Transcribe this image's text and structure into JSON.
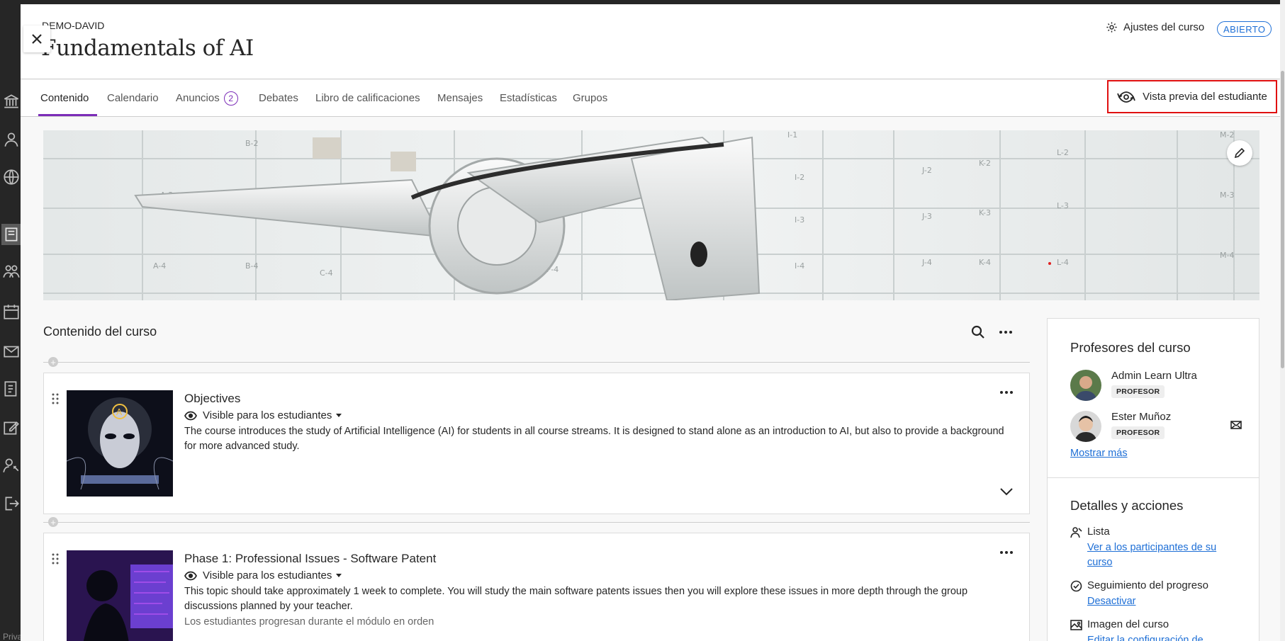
{
  "window": {
    "close_label": "Close"
  },
  "rail": {
    "items": [
      "institution-icon",
      "profile-icon",
      "globe-icon",
      "courses-icon",
      "organizations-icon",
      "calendar-icon",
      "messages-icon",
      "grades-icon",
      "edit-icon",
      "tools-icon",
      "signout-icon"
    ],
    "footer_text": "Priva"
  },
  "header": {
    "org": "DEMO-DAVID",
    "title": "Fundamentals of AI",
    "settings_label": "Ajustes del curso",
    "status_badge": "ABIERTO"
  },
  "nav": {
    "tabs": [
      {
        "label": "Contenido",
        "active": true
      },
      {
        "label": "Calendario"
      },
      {
        "label": "Anuncios",
        "count": "2"
      },
      {
        "label": "Debates"
      },
      {
        "label": "Libro de calificaciones"
      },
      {
        "label": "Mensajes"
      },
      {
        "label": "Estadísticas"
      },
      {
        "label": "Grupos"
      }
    ],
    "student_preview": "Vista previa del estudiante"
  },
  "banner": {
    "alt": "course banner: industrial robot arm in warehouse"
  },
  "content": {
    "section_title": "Contenido del curso",
    "items": [
      {
        "title": "Objectives",
        "visibility": "Visible para los estudiantes",
        "description": "The course introduces the study of Artificial Intelligence (AI) for students in all course streams. It is designed to stand alone as an introduction to AI, but also to provide a background for more advanced study."
      },
      {
        "title": "Phase 1: Professional Issues - Software Patent",
        "visibility": "Visible para los estudiantes",
        "description": "This topic should take approximately 1 week to complete. You will study the main software patents issues then you will explore these issues in more depth through the group discussions planned by your teacher.",
        "note": "Los estudiantes progresan durante el módulo en orden"
      }
    ]
  },
  "sidebar": {
    "instructors_title": "Profesores del curso",
    "instructors": [
      {
        "name": "Admin Learn Ultra",
        "role": "PROFESOR"
      },
      {
        "name": "Ester Muñoz",
        "role": "PROFESOR"
      }
    ],
    "show_more": "Mostrar más",
    "details_title": "Detalles y acciones",
    "actions": [
      {
        "title": "Lista",
        "link": "Ver a los participantes de su curso"
      },
      {
        "title": "Seguimiento del progreso",
        "link": "Desactivar"
      },
      {
        "title": "Imagen del curso",
        "link": "Editar la configuración de"
      }
    ]
  },
  "colors": {
    "accent": "#7c2db8",
    "link": "#1e6fd6",
    "highlight_box": "#e01010",
    "rail": "#262626"
  }
}
